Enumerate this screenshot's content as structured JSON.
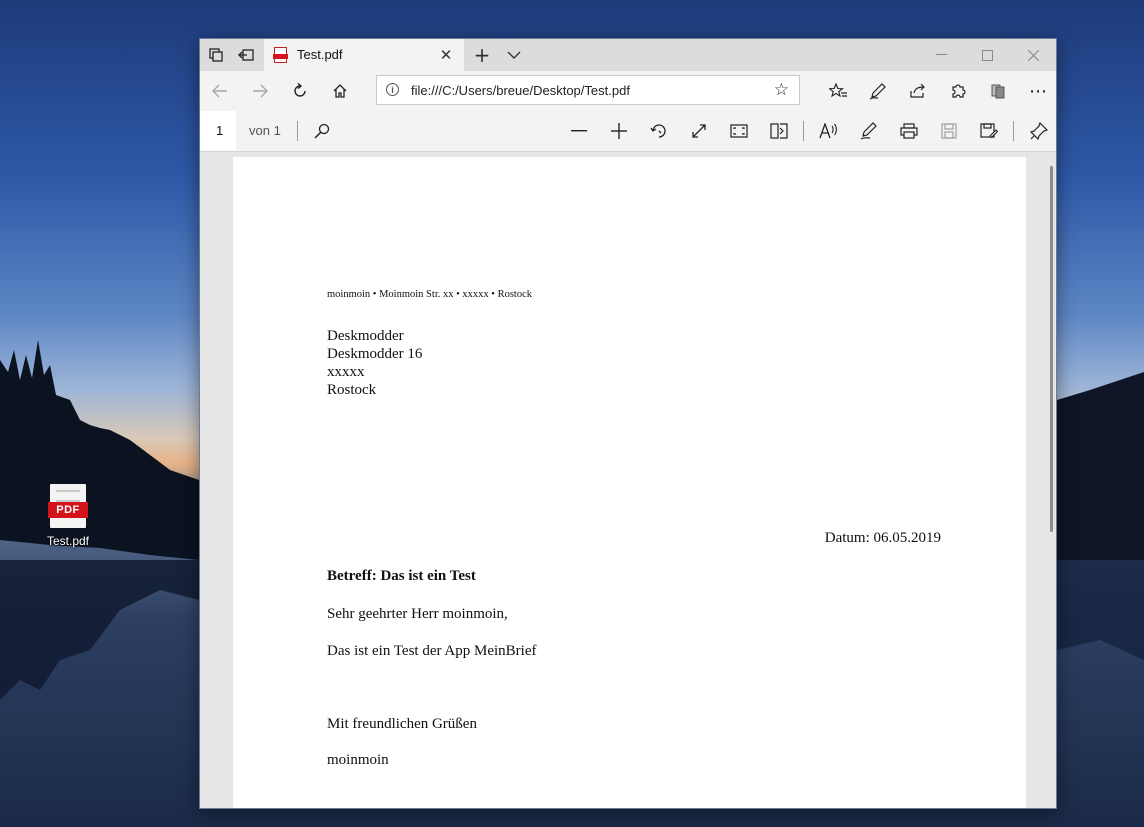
{
  "desktop": {
    "icon_label": "Test.pdf",
    "icon_badge": "PDF"
  },
  "browser": {
    "tab_title": "Test.pdf",
    "url": "file:///C:/Users/breue/Desktop/Test.pdf",
    "icons": {
      "tab_actions": "tab-actions-icon",
      "set_aside": "set-aside-tabs-icon",
      "new_tab": "plus-icon",
      "tab_preview": "chevron-down-icon",
      "back": "arrow-left-icon",
      "forward": "arrow-right-icon",
      "refresh": "refresh-icon",
      "home": "home-icon",
      "favorites_star": "star-icon",
      "favorites": "favorites-list-icon",
      "notes": "pen-icon",
      "share": "share-icon",
      "extensions": "puzzle-icon",
      "collections": "collections-icon",
      "more": "more-icon"
    }
  },
  "pdf_toolbar": {
    "page_number": "1",
    "page_of": "von 1"
  },
  "document": {
    "sender_line": "moinmoin • Moinmoin Str. xx • xxxxx • Rostock",
    "recipient": [
      "Deskmodder",
      "Deskmodder 16",
      "xxxxx",
      "Rostock"
    ],
    "date": "Datum: 06.05.2019",
    "subject": "Betreff: Das ist ein Test",
    "salutation": "Sehr geehrter Herr moinmoin,",
    "body": "Das ist ein Test der App MeinBrief",
    "closing": "Mit freundlichen Grüßen",
    "signature": "moinmoin"
  },
  "colors": {
    "pdf_red": "#d4141b",
    "toolbar_bg": "#f3f3f3",
    "titlebar_bg": "#dcdcdc",
    "viewer_bg": "#e6e6e6"
  }
}
